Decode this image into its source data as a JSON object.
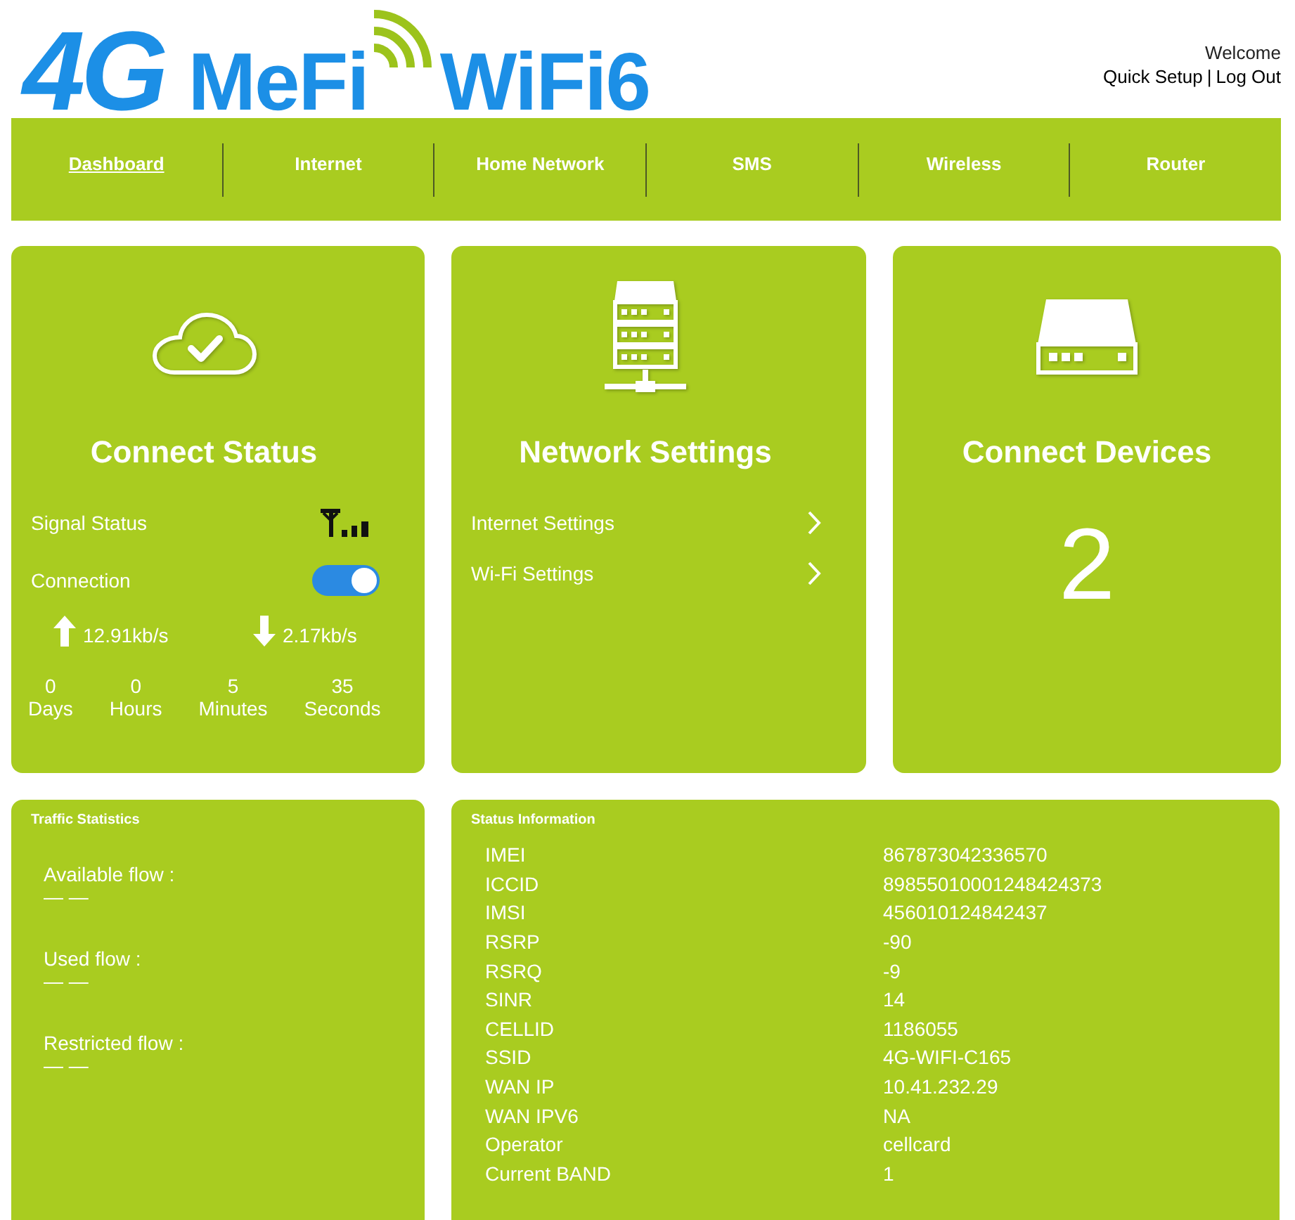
{
  "header": {
    "logo": [
      {
        "text": "4G",
        "kind": "italic"
      },
      {
        "text": "MeFi",
        "kind": "plain"
      },
      {
        "text": "WiFi6",
        "kind": "plain"
      }
    ],
    "welcome": "Welcome",
    "links": [
      {
        "label": "Quick Setup"
      },
      {
        "label": "Log Out"
      }
    ],
    "separator": "|"
  },
  "nav": [
    {
      "label": "Dashboard",
      "selected": true
    },
    {
      "label": "Internet",
      "selected": false
    },
    {
      "label": "Home Network",
      "selected": false
    },
    {
      "label": "SMS",
      "selected": false
    },
    {
      "label": "Wireless",
      "selected": false
    },
    {
      "label": "Router",
      "selected": false
    }
  ],
  "connect_status": {
    "title": "Connect Status",
    "signal_label": "Signal Status",
    "connection_label": "Connection",
    "connection_on": true,
    "speeds": [
      {
        "kind": "upload",
        "value": "12.91kb/s"
      },
      {
        "kind": "download",
        "value": "2.17kb/s"
      }
    ],
    "uptime": [
      {
        "value": "0",
        "unit": "Days"
      },
      {
        "value": "0",
        "unit": "Hours"
      },
      {
        "value": "5",
        "unit": "Minutes"
      },
      {
        "value": "35",
        "unit": "Seconds"
      }
    ]
  },
  "network_settings": {
    "title": "Network Settings",
    "links": [
      {
        "label": "Internet Settings"
      },
      {
        "label": "Wi-Fi Settings"
      }
    ]
  },
  "connect_devices": {
    "title": "Connect Devices",
    "count": "2"
  },
  "traffic_statistics": {
    "title": "Traffic Statistics",
    "items": [
      {
        "label": "Available flow :",
        "value": "— —"
      },
      {
        "label": "Used flow :",
        "value": "— —"
      },
      {
        "label": "Restricted flow :",
        "value": "— —"
      }
    ]
  },
  "status_information": {
    "title": "Status Information",
    "rows": [
      {
        "label": "IMEI",
        "value": "867873042336570"
      },
      {
        "label": "ICCID",
        "value": "89855010001248424373"
      },
      {
        "label": "IMSI",
        "value": "456010124842437"
      },
      {
        "label": "RSRP",
        "value": "-90"
      },
      {
        "label": "RSRQ",
        "value": "-9"
      },
      {
        "label": "SINR",
        "value": "14"
      },
      {
        "label": "CELLID",
        "value": "1186055"
      },
      {
        "label": "SSID",
        "value": "4G-WIFI-C165"
      },
      {
        "label": "WAN IP",
        "value": "10.41.232.29"
      },
      {
        "label": "WAN IPV6",
        "value": "NA"
      },
      {
        "label": "Operator",
        "value": "cellcard"
      },
      {
        "label": "Current BAND",
        "value": "1"
      }
    ]
  }
}
